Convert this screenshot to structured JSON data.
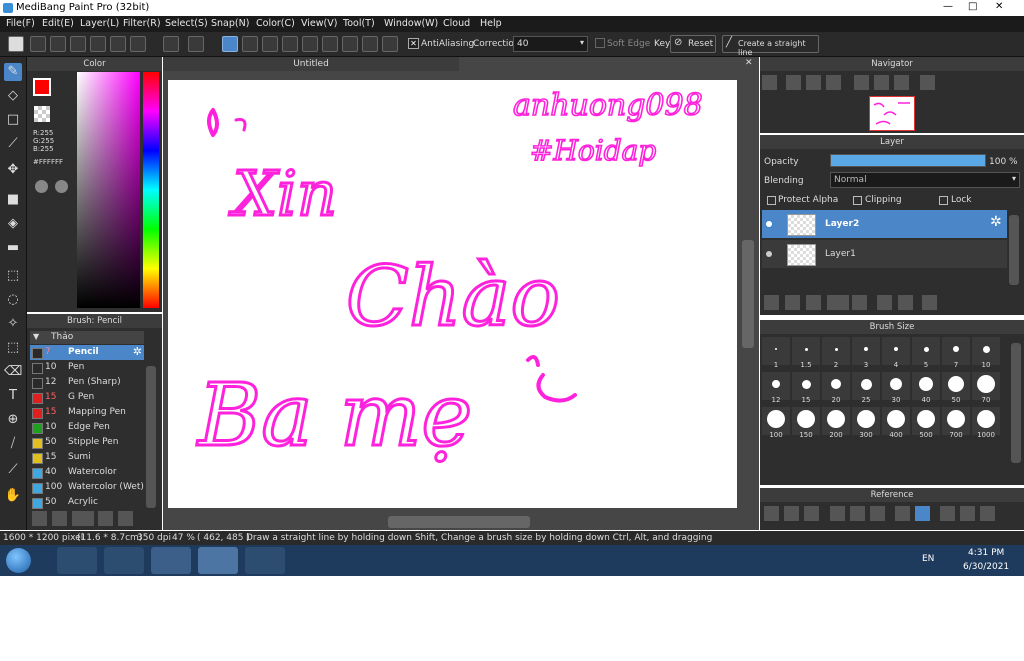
{
  "app": {
    "title": "MediBang Paint Pro (32bit)"
  },
  "window_controls": {
    "minimize": "—",
    "maximize": "□",
    "close": "✕"
  },
  "menu": [
    "File(F)",
    "Edit(E)",
    "Layer(L)",
    "Filter(R)",
    "Select(S)",
    "Snap(N)",
    "Color(C)",
    "View(V)",
    "Tool(T)",
    "Window(W)",
    "Cloud",
    "Help"
  ],
  "toolbar": {
    "antialiasing_label": "AntiAliasing",
    "correction_label": "Correction",
    "correction_value": "40",
    "soft_edge_label": "Soft Edge",
    "key_label": "Key",
    "reset_label": "Reset",
    "straight_line_label": "Create a straight line"
  },
  "color_panel": {
    "title": "Color",
    "r": "R:255",
    "g": "G:255",
    "b": "B:255",
    "hex": "#FFFFFF",
    "fg_color": "#ff0000"
  },
  "brush_panel": {
    "title": "Brush: Pencil",
    "group": "Thảo",
    "items": [
      {
        "size": "7",
        "name": "Pencil",
        "color": "#2a2a2a",
        "selected": true
      },
      {
        "size": "10",
        "name": "Pen",
        "color": "#2a2a2a"
      },
      {
        "size": "12",
        "name": "Pen (Sharp)",
        "color": "#2a2a2a"
      },
      {
        "size": "15",
        "name": "G Pen",
        "color": "#e02020"
      },
      {
        "size": "15",
        "name": "Mapping Pen",
        "color": "#e02020"
      },
      {
        "size": "10",
        "name": "Edge Pen",
        "color": "#20a020"
      },
      {
        "size": "50",
        "name": "Stipple Pen",
        "color": "#e0c020"
      },
      {
        "size": "15",
        "name": "Sumi",
        "color": "#e0c020"
      },
      {
        "size": "40",
        "name": "Watercolor",
        "color": "#40a8e0"
      },
      {
        "size": "100",
        "name": "Watercolor (Wet)",
        "color": "#40a8e0"
      },
      {
        "size": "50",
        "name": "Acrylic",
        "color": "#40a8e0"
      }
    ]
  },
  "canvas": {
    "tab_title": "Untitled"
  },
  "artwork": {
    "signature": "anhuong098",
    "hashtag": "#Hoidap",
    "line1": "Xin",
    "line2": "Chào",
    "line3": "Ba mẹ",
    "ink_color": "#ff22dd"
  },
  "navigator": {
    "title": "Navigator"
  },
  "layer_panel": {
    "title": "Layer",
    "opacity_label": "Opacity",
    "opacity_value": "100 %",
    "opacity_fraction": 1.0,
    "blending_label": "Blending",
    "blending_value": "Normal",
    "protect_alpha_label": "Protect Alpha",
    "clipping_label": "Clipping",
    "lock_label": "Lock",
    "layers": [
      {
        "name": "Layer2",
        "selected": true
      },
      {
        "name": "Layer1",
        "selected": false
      }
    ]
  },
  "brush_size_panel": {
    "title": "Brush Size",
    "sizes": [
      "1",
      "1.5",
      "2",
      "3",
      "4",
      "5",
      "7",
      "10",
      "12",
      "15",
      "20",
      "25",
      "30",
      "40",
      "50",
      "70",
      "100",
      "150",
      "200",
      "300",
      "400",
      "500",
      "700",
      "1000"
    ]
  },
  "reference_panel": {
    "title": "Reference"
  },
  "status": {
    "pixels": "1600 * 1200 pixel",
    "cm": "(11.6 * 8.7cm)",
    "dpi": "350 dpi",
    "zoom": "47 %",
    "coords": "( 462, 485 )",
    "hint": "Draw a straight line by holding down Shift, Change a brush size by holding down Ctrl, Alt, and dragging"
  },
  "taskbar": {
    "lang": "EN",
    "time": "4:31 PM",
    "date": "6/30/2021"
  }
}
